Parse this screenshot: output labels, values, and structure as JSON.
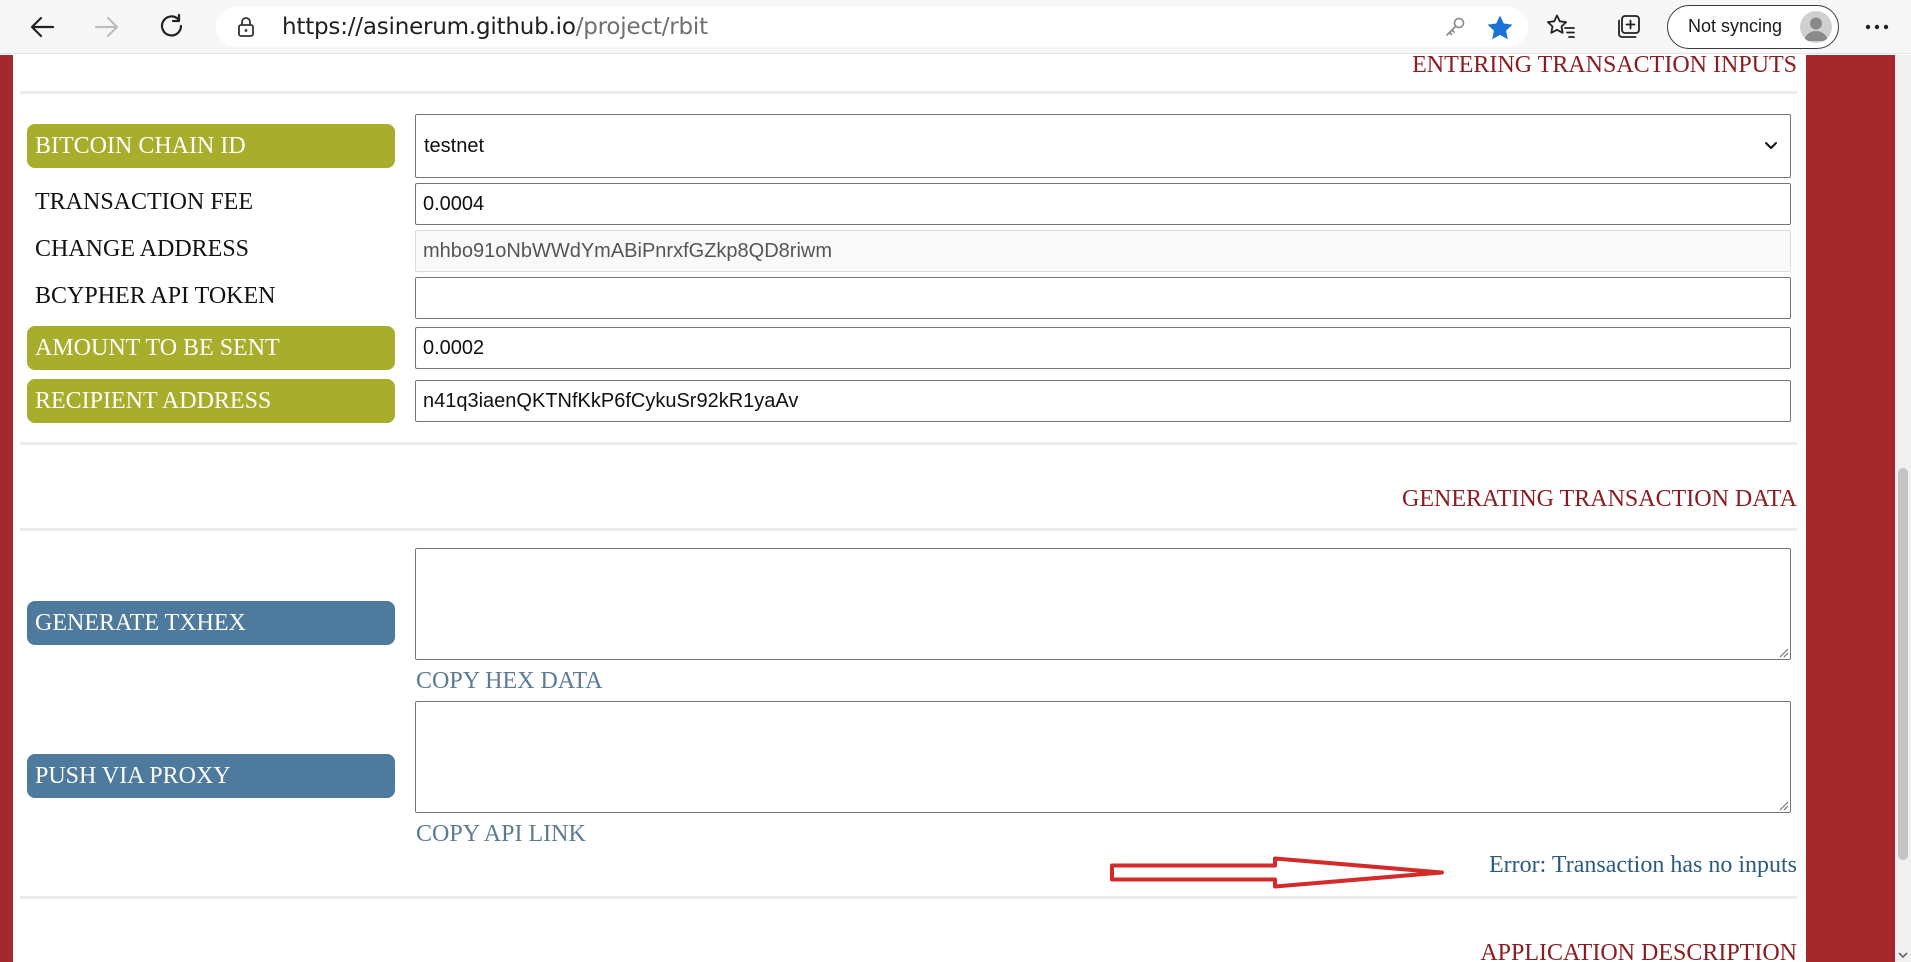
{
  "browser": {
    "url_host": "https://asinerum.github.io",
    "url_path": "/project/rbit",
    "sync_label": "Not syncing",
    "icons": [
      "back-icon",
      "forward-icon",
      "refresh-icon",
      "lock-icon",
      "key-icon",
      "star-icon",
      "favorites-icon",
      "collections-icon",
      "avatar-icon",
      "more-icon"
    ]
  },
  "colors": {
    "frame_red": "#a4282c",
    "section_title": "#8b1c22",
    "olive_label": "#a8ad2b",
    "steel_label": "#4d7a9d",
    "error_text": "#2b5a82",
    "annotation_arrow": "#d42a2a"
  },
  "sections": {
    "inputs_title": "ENTERING TRANSACTION INPUTS",
    "generate_title": "GENERATING TRANSACTION DATA",
    "description_title": "APPLICATION DESCRIPTION"
  },
  "form": {
    "chain_id": {
      "label": "BITCOIN CHAIN ID",
      "value": "testnet"
    },
    "fee": {
      "label": "TRANSACTION FEE",
      "value": "0.0004"
    },
    "change_address": {
      "label": "CHANGE ADDRESS",
      "value": "mhbo91oNbWWdYmABiPnrxfGZkp8QD8riwm"
    },
    "api_token": {
      "label": "BCYPHER API TOKEN",
      "value": ""
    },
    "amount": {
      "label": "AMOUNT TO BE SENT",
      "value": "0.0002"
    },
    "recipient": {
      "label": "RECIPIENT ADDRESS",
      "value": "n41q3iaenQKTNfKkP6fCykuSr92kR1yaAv"
    }
  },
  "generate": {
    "txhex_button": "GENERATE TXHEX",
    "copy_hex": "COPY HEX DATA",
    "push_button": "PUSH VIA PROXY",
    "copy_api": "COPY API LINK",
    "error": "Error: Transaction has no inputs"
  }
}
